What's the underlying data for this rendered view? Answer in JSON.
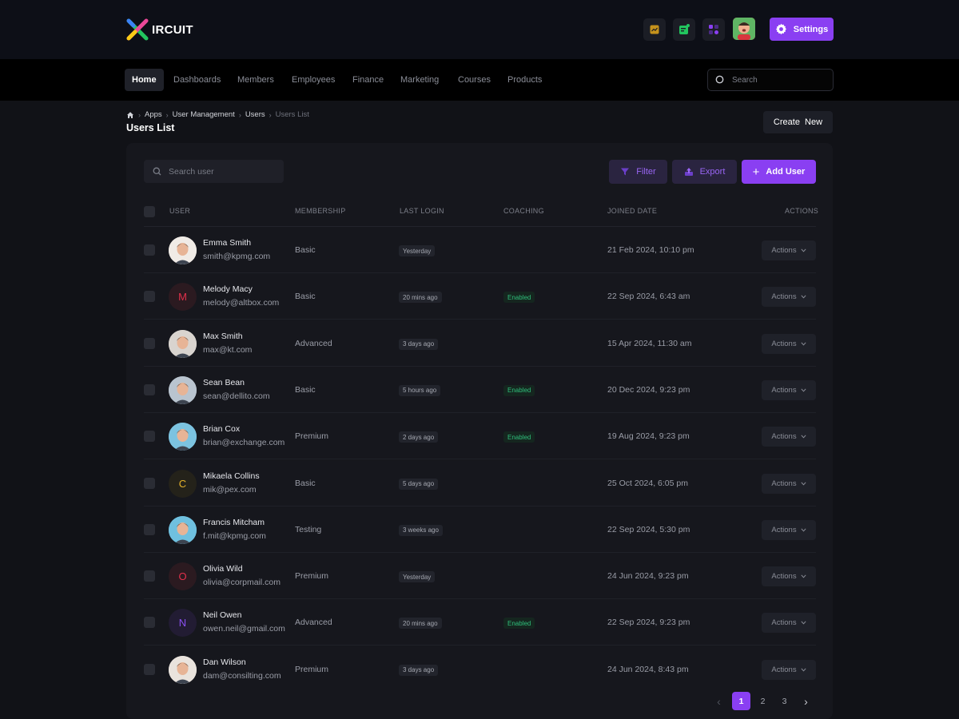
{
  "brand": {
    "logo_text": "IRCUIT"
  },
  "header": {
    "settings_label": "Settings"
  },
  "nav": {
    "items": [
      "Home",
      "Dashboards",
      "Members",
      "Employees",
      "Finance",
      "Marketing",
      "Courses",
      "Products"
    ],
    "active": "Home",
    "search_placeholder": "Search"
  },
  "breadcrumb": {
    "items": [
      "Apps",
      "User Management",
      "Users",
      "Users List"
    ]
  },
  "page": {
    "title": "Users List",
    "create_label": "Create  New"
  },
  "toolbar": {
    "search_placeholder": "Search user",
    "filter_label": "Filter",
    "export_label": "Export",
    "add_label": "Add User"
  },
  "table": {
    "headers": {
      "user": "USER",
      "membership": "MEMBERSHIP",
      "last_login": "LAST LOGIN",
      "coaching": "COACHING",
      "joined": "JOINED DATE",
      "actions": "ACTIONS"
    },
    "actions_label": "Actions",
    "rows": [
      {
        "name": "Emma Smith",
        "email": "smith@kpmg.com",
        "membership": "Basic",
        "last_login": "Yesterday",
        "coaching": "",
        "joined": "21 Feb 2024, 10:10 pm",
        "initial": "",
        "avatar_bg": "#f0ebe6"
      },
      {
        "name": "Melody Macy",
        "email": "melody@altbox.com",
        "membership": "Basic",
        "last_login": "20 mins ago",
        "coaching": "Enabled",
        "joined": "22 Sep 2024, 6:43 am",
        "initial": "M",
        "avatar_bg": "#2b1a20",
        "initial_color": "#e1304b"
      },
      {
        "name": "Max Smith",
        "email": "max@kt.com",
        "membership": "Advanced",
        "last_login": "3 days ago",
        "coaching": "",
        "joined": "15 Apr 2024, 11:30 am",
        "initial": "",
        "avatar_bg": "#d9d4cf"
      },
      {
        "name": "Sean Bean",
        "email": "sean@dellito.com",
        "membership": "Basic",
        "last_login": "5 hours ago",
        "coaching": "Enabled",
        "joined": "20 Dec 2024, 9:23 pm",
        "initial": "",
        "avatar_bg": "#b9c4cf"
      },
      {
        "name": "Brian Cox",
        "email": "brian@exchange.com",
        "membership": "Premium",
        "last_login": "2 days ago",
        "coaching": "Enabled",
        "joined": "19 Aug 2024, 9:23 pm",
        "initial": "",
        "avatar_bg": "#7cc3e0"
      },
      {
        "name": "Mikaela Collins",
        "email": "mik@pex.com",
        "membership": "Basic",
        "last_login": "5 days ago",
        "coaching": "",
        "joined": "25 Oct 2024, 6:05 pm",
        "initial": "C",
        "avatar_bg": "#24221a",
        "initial_color": "#e4b12a"
      },
      {
        "name": "Francis Mitcham",
        "email": "f.mit@kpmg.com",
        "membership": "Testing",
        "last_login": "3 weeks ago",
        "coaching": "",
        "joined": "22 Sep 2024, 5:30 pm",
        "initial": "",
        "avatar_bg": "#6fc0df"
      },
      {
        "name": "Olivia Wild",
        "email": "olivia@corpmail.com",
        "membership": "Premium",
        "last_login": "Yesterday",
        "coaching": "",
        "joined": "24 Jun 2024, 9:23 pm",
        "initial": "O",
        "avatar_bg": "#2b1a20",
        "initial_color": "#e1304b"
      },
      {
        "name": "Neil Owen",
        "email": "owen.neil@gmail.com",
        "membership": "Advanced",
        "last_login": "20 mins ago",
        "coaching": "Enabled",
        "joined": "22 Sep 2024, 9:23 pm",
        "initial": "N",
        "avatar_bg": "#221c33",
        "initial_color": "#8a4ff2"
      },
      {
        "name": "Dan Wilson",
        "email": "dam@consilting.com",
        "membership": "Premium",
        "last_login": "3 days ago",
        "coaching": "",
        "joined": "24 Jun 2024, 8:43 pm",
        "initial": "",
        "avatar_bg": "#e9e3dd"
      }
    ]
  },
  "pagination": {
    "pages": [
      "1",
      "2",
      "3"
    ],
    "current": "1"
  },
  "colors": {
    "accent": "#8a3ff2",
    "success": "#2fbf7b",
    "background": "#111217",
    "card": "#16171d"
  }
}
